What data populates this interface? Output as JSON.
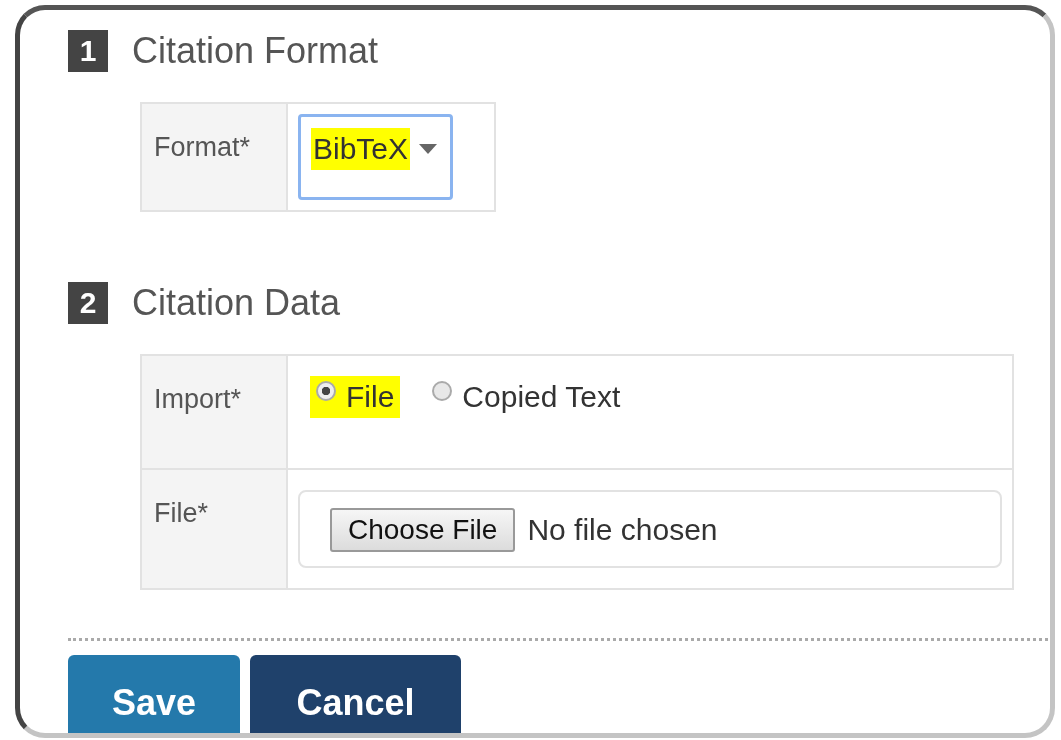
{
  "sections": [
    {
      "number": "1",
      "title": "Citation Format",
      "fields": [
        {
          "kind": "select",
          "label": "Format*",
          "value": "BibTeX",
          "highlighted": true
        }
      ]
    },
    {
      "number": "2",
      "title": "Citation Data",
      "fields": [
        {
          "kind": "radio",
          "label": "Import*",
          "options": [
            {
              "label": "File",
              "selected": true,
              "highlighted": true
            },
            {
              "label": "Copied Text",
              "selected": false,
              "highlighted": false
            }
          ]
        },
        {
          "kind": "file",
          "label": "File*",
          "button": "Choose File",
          "status": "No file chosen"
        }
      ]
    }
  ],
  "buttons": [
    {
      "label": "Save",
      "kind": "primary"
    },
    {
      "label": "Cancel",
      "kind": "secondary"
    }
  ]
}
